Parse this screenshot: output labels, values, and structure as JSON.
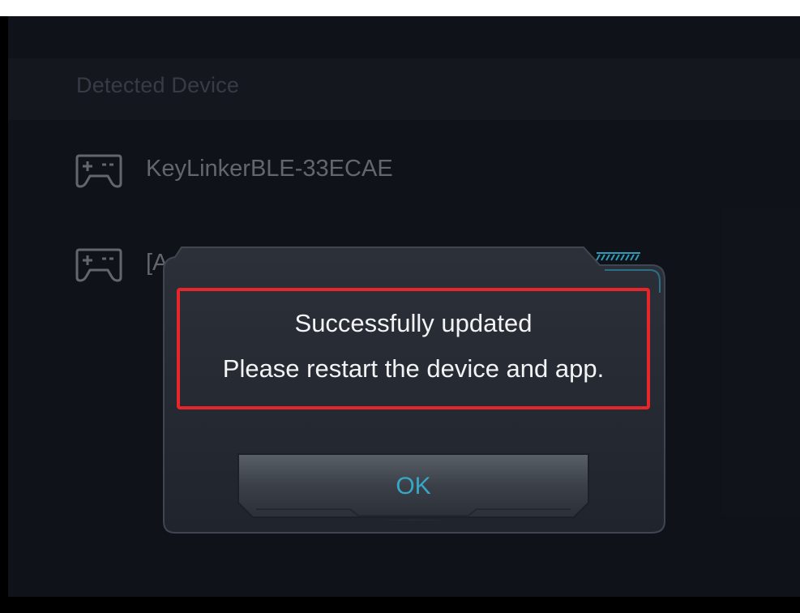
{
  "section": {
    "title": "Detected Device"
  },
  "devices": [
    {
      "name": "KeyLinkerBLE-33ECAE",
      "icon": "gamepad-icon"
    },
    {
      "name": "[A",
      "icon": "gamepad-icon"
    }
  ],
  "dialog": {
    "message_line1": "Successfully updated",
    "message_line2": "Please restart the device and app.",
    "ok_label": "OK",
    "highlight_color": "#e8262a",
    "accent_color": "#37a7c6"
  }
}
